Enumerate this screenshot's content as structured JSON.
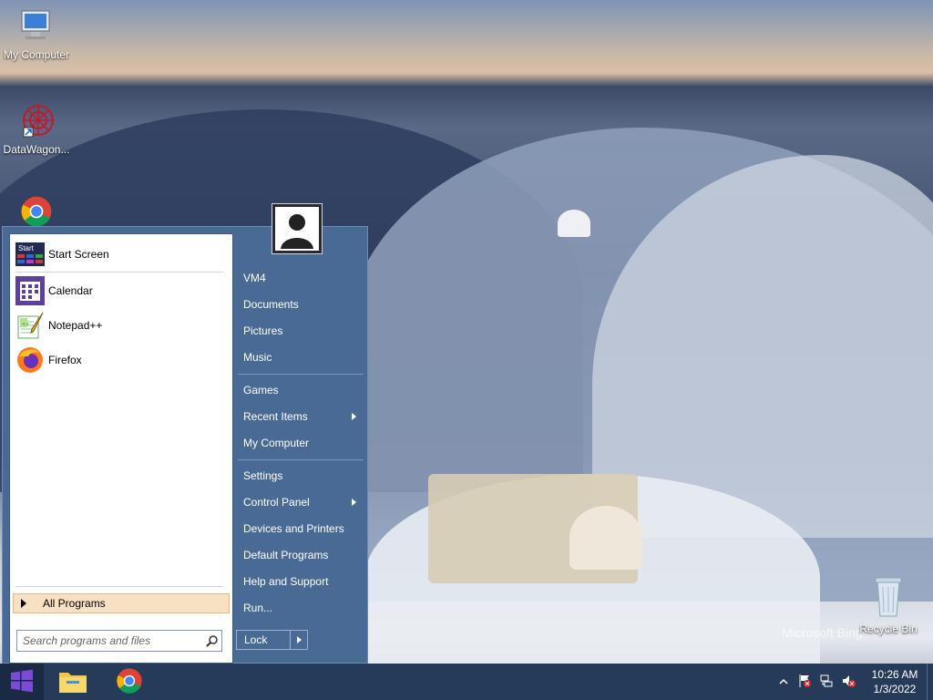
{
  "desktop": {
    "icons": [
      {
        "label": "My Computer",
        "icon": "computer-icon"
      },
      {
        "label": "DataWagon...",
        "icon": "datawagon-icon"
      },
      {
        "label": "",
        "icon": "chrome-icon"
      },
      {
        "label": "Recycle Bin",
        "icon": "recycle-bin-icon"
      }
    ],
    "watermark": "Microsoft Bing"
  },
  "start_menu": {
    "programs": [
      {
        "label": "Start Screen",
        "icon": "start-screen-icon"
      },
      {
        "label": "Calendar",
        "icon": "calendar-icon"
      },
      {
        "label": "Notepad++",
        "icon": "notepadpp-icon"
      },
      {
        "label": "Firefox",
        "icon": "firefox-icon"
      }
    ],
    "start_screen_badge": "Start",
    "all_programs": "All Programs",
    "search_placeholder": "Search programs and files",
    "right_items": [
      {
        "label": "VM4"
      },
      {
        "label": "Documents"
      },
      {
        "label": "Pictures"
      },
      {
        "label": "Music"
      },
      {
        "label": "Games"
      },
      {
        "label": "Recent Items",
        "submenu": true
      },
      {
        "label": "My Computer"
      },
      {
        "label": "Settings"
      },
      {
        "label": "Control Panel",
        "submenu": true
      },
      {
        "label": "Devices and Printers"
      },
      {
        "label": "Default Programs"
      },
      {
        "label": "Help and Support"
      },
      {
        "label": "Run..."
      }
    ],
    "lock_label": "Lock"
  },
  "taskbar": {
    "pinned": [
      "file-explorer-icon",
      "chrome-icon"
    ],
    "tray_icons": [
      "show-hidden-icons-chevron",
      "action-center-flag-icon",
      "network-icon",
      "volume-muted-icon"
    ],
    "time": "10:26 AM",
    "date": "1/3/2022"
  },
  "colors": {
    "menu_blue": "#4a6a96",
    "taskbar": "#263a5a",
    "all_programs_highlight": "#f8e1c3"
  }
}
